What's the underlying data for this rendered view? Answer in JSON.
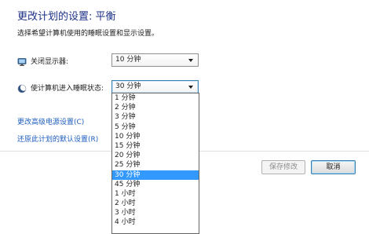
{
  "header": {
    "title": "更改计划的设置: 平衡",
    "subtitle": "选择希望计算机使用的睡眠设置和显示设置。"
  },
  "settings": {
    "display": {
      "label": "关闭显示器:",
      "value": "10 分钟",
      "icon": "monitor-icon"
    },
    "sleep": {
      "label": "使计算机进入睡眠状态:",
      "value": "30 分钟",
      "icon": "moon-icon"
    }
  },
  "links": {
    "advanced": "更改高级电源设置(C)",
    "restore": "还原此计划的默认设置(R)"
  },
  "buttons": {
    "save": "保存修改",
    "cancel": "取消"
  },
  "dropdown": {
    "options": [
      "1 分钟",
      "2 分钟",
      "3 分钟",
      "5 分钟",
      "10 分钟",
      "15 分钟",
      "20 分钟",
      "25 分钟",
      "30 分钟",
      "45 分钟",
      "1 小时",
      "2 小时",
      "3 小时",
      "4 小时"
    ],
    "selected_index": 8
  },
  "colors": {
    "title": "#1e3287",
    "link": "#1e5dbd",
    "selection": "#3399ff"
  }
}
